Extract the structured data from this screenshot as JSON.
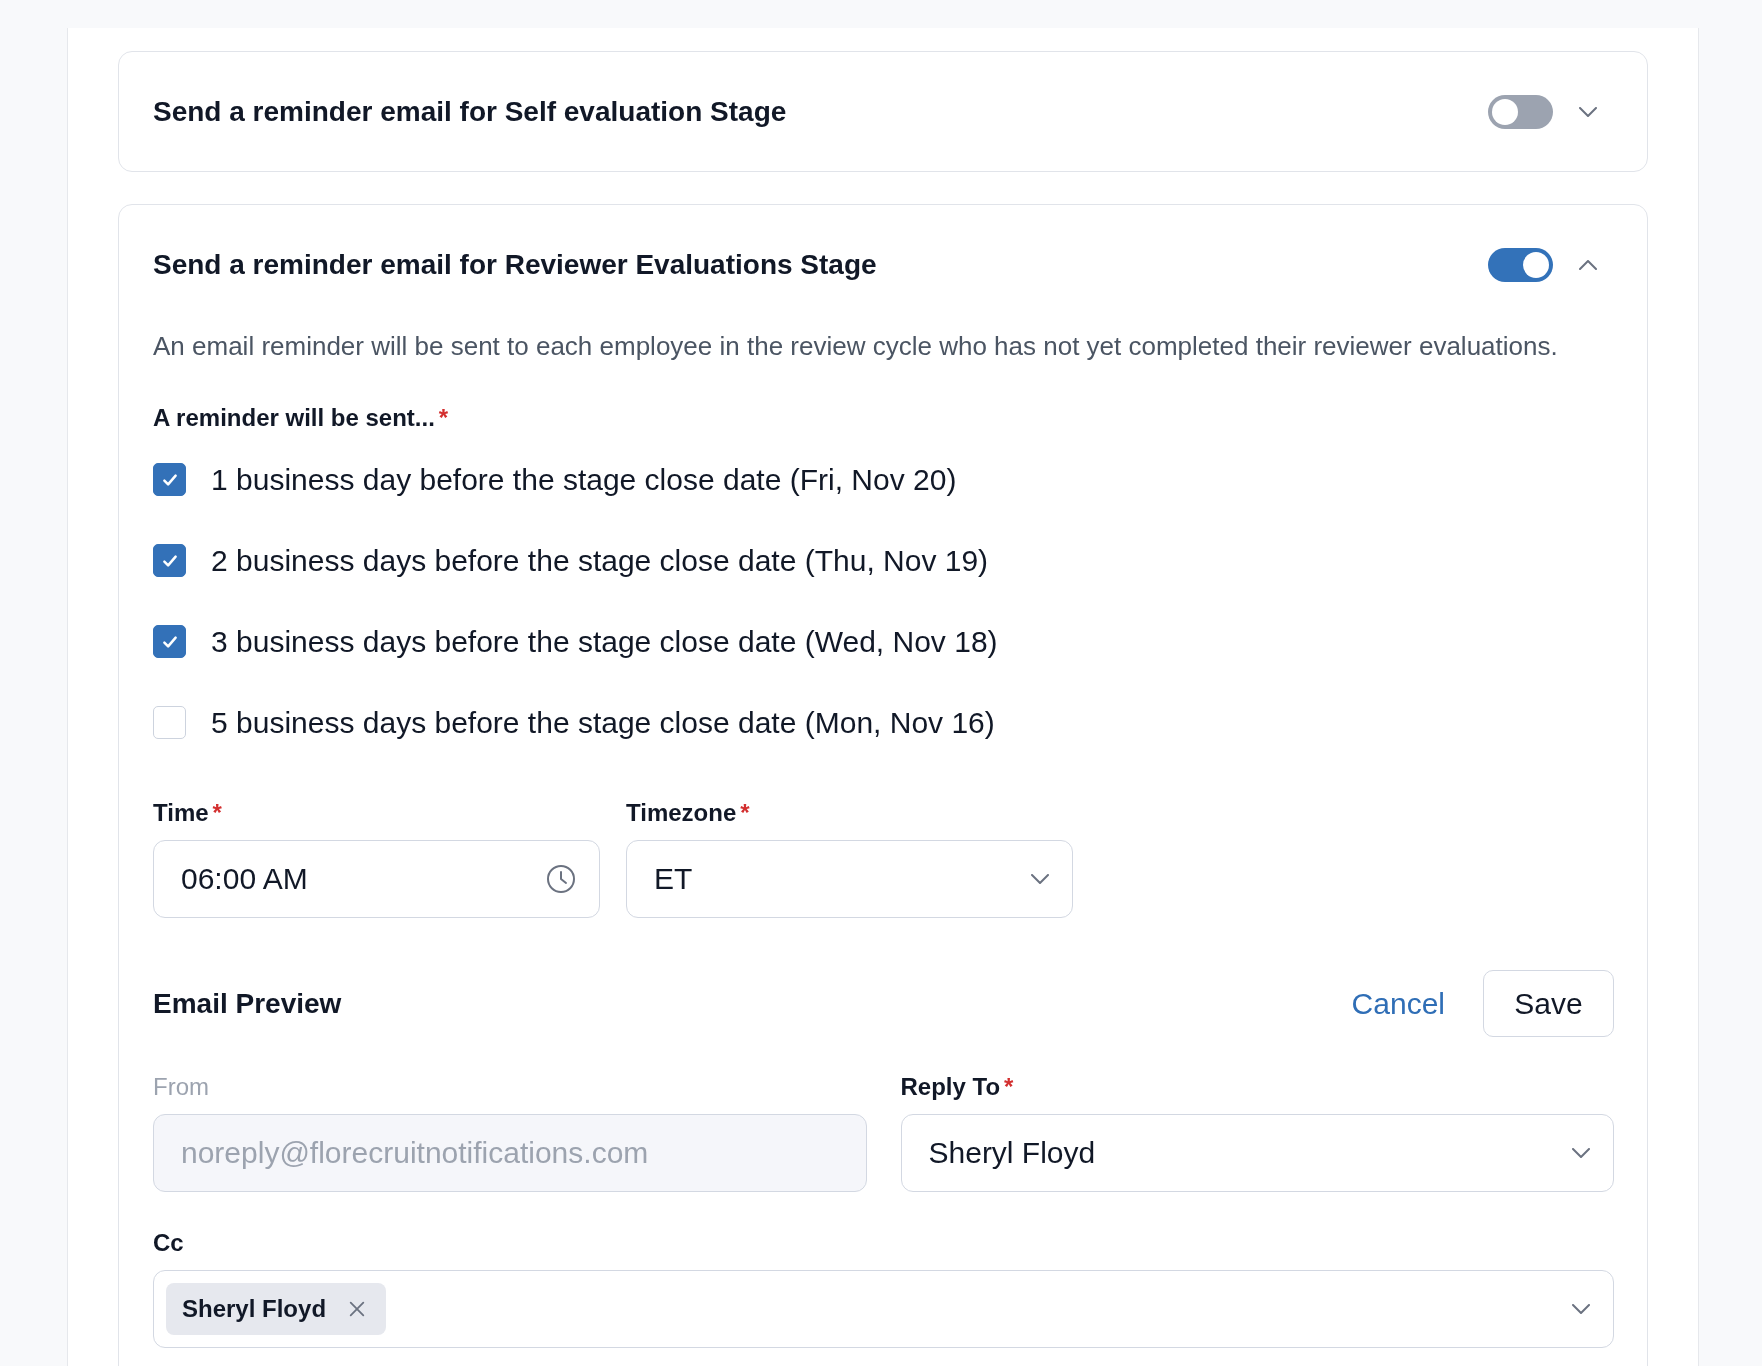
{
  "sections": [
    {
      "title": "Send a reminder email for Self evaluation Stage",
      "enabled": false,
      "expanded": false
    },
    {
      "title": "Send a reminder email for Reviewer Evaluations Stage",
      "enabled": true,
      "expanded": true,
      "description": "An email reminder will be sent to each employee in the review cycle who has not yet completed their reviewer evaluations.",
      "schedule": {
        "label": "A reminder will be sent...",
        "required_mark": "*",
        "options": [
          {
            "label": "1 business day before the stage close date (Fri, Nov 20)",
            "checked": true
          },
          {
            "label": "2 business days before the stage close date (Thu, Nov 19)",
            "checked": true
          },
          {
            "label": "3 business days before the stage close date (Wed, Nov 18)",
            "checked": true
          },
          {
            "label": "5 business days before the stage close date (Mon, Nov 16)",
            "checked": false
          }
        ]
      },
      "settings": [
        {
          "kind": "time",
          "label": "Time",
          "required_mark": "*",
          "value": "06:00 AM"
        },
        {
          "kind": "select",
          "label": "Timezone",
          "required_mark": "*",
          "value": "ET"
        }
      ],
      "email_preview": {
        "title": "Email Preview",
        "actions": [
          {
            "kind": "link",
            "label": "Cancel"
          },
          {
            "kind": "button",
            "label": "Save"
          }
        ],
        "fields": [
          {
            "kind": "text",
            "label": "From",
            "value": "noreply@florecruitnotifications.com",
            "disabled": true
          },
          {
            "kind": "select",
            "label": "Reply To",
            "required_mark": "*",
            "value": "Sheryl Floyd",
            "disabled": false
          },
          {
            "kind": "multiselect",
            "label": "Cc",
            "chips": [
              {
                "label": "Sheryl Floyd"
              }
            ],
            "disabled": false
          }
        ]
      }
    }
  ]
}
